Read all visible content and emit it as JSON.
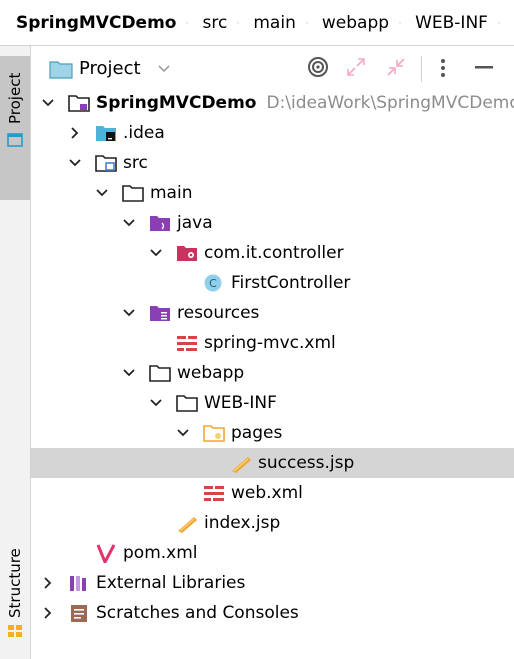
{
  "breadcrumb": [
    "SpringMVCDemo",
    "src",
    "main",
    "webapp",
    "WEB-INF"
  ],
  "tool_windows": {
    "project_tab": "Project",
    "structure_tab": "Structure"
  },
  "panel": {
    "title": "Project",
    "icons": [
      "target-icon",
      "expand-icon",
      "collapse-icon",
      "more-icon",
      "minimize-icon"
    ]
  },
  "tree": [
    {
      "label": "SpringMVCDemo",
      "path": "D:\\ideaWork\\SpringMVCDemo",
      "bold": true,
      "expanded": true,
      "icon": "module-folder-icon"
    },
    {
      "label": ".idea",
      "expanded": false,
      "icon": "idea-folder-icon"
    },
    {
      "label": "src",
      "expanded": true,
      "icon": "source-root-folder-icon"
    },
    {
      "label": "main",
      "expanded": true,
      "icon": "folder-icon"
    },
    {
      "label": "java",
      "expanded": true,
      "icon": "java-source-folder-icon"
    },
    {
      "label": "com.it.controller",
      "expanded": true,
      "icon": "package-icon"
    },
    {
      "label": "FirstController",
      "icon": "class-icon"
    },
    {
      "label": "resources",
      "expanded": true,
      "icon": "resources-folder-icon"
    },
    {
      "label": "spring-mvc.xml",
      "icon": "spring-xml-icon"
    },
    {
      "label": "webapp",
      "expanded": true,
      "icon": "folder-icon"
    },
    {
      "label": "WEB-INF",
      "expanded": true,
      "icon": "folder-icon"
    },
    {
      "label": "pages",
      "expanded": true,
      "icon": "web-folder-icon"
    },
    {
      "label": "success.jsp",
      "selected": true,
      "icon": "jsp-icon"
    },
    {
      "label": "web.xml",
      "icon": "web-xml-icon"
    },
    {
      "label": "index.jsp",
      "icon": "jsp-icon"
    },
    {
      "label": "pom.xml",
      "icon": "maven-icon"
    },
    {
      "label": "External Libraries",
      "expanded": false,
      "icon": "libraries-icon"
    },
    {
      "label": "Scratches and Consoles",
      "expanded": false,
      "icon": "scratches-icon"
    }
  ],
  "colors": {
    "selection": "#d5d5d5",
    "strip_active": "#c6c6c6",
    "path_gray": "#8c8c8c",
    "folder_purple": "#8a3fb3",
    "class_teal": "#4fb8d8",
    "jsp_orange": "#f0a732",
    "xml_red": "#d64545"
  }
}
